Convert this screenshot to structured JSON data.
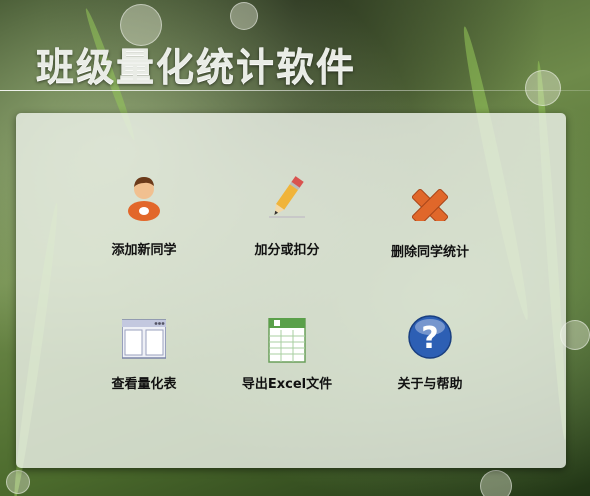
{
  "app": {
    "title": "班级量化统计软件"
  },
  "menu": {
    "items": [
      {
        "label": "添加新同学",
        "icon": "student-avatar-icon"
      },
      {
        "label": "加分或扣分",
        "icon": "pencil-icon"
      },
      {
        "label": "删除同学统计",
        "icon": "delete-x-icon"
      },
      {
        "label": "查看量化表",
        "icon": "table-window-icon"
      },
      {
        "label": "导出Excel文件",
        "icon": "excel-sheet-icon"
      },
      {
        "label": "关于与帮助",
        "icon": "help-question-icon"
      }
    ]
  },
  "colors": {
    "panel": "#ecf0e8",
    "accent_orange": "#e2672a",
    "help_blue": "#2d5fb4"
  }
}
